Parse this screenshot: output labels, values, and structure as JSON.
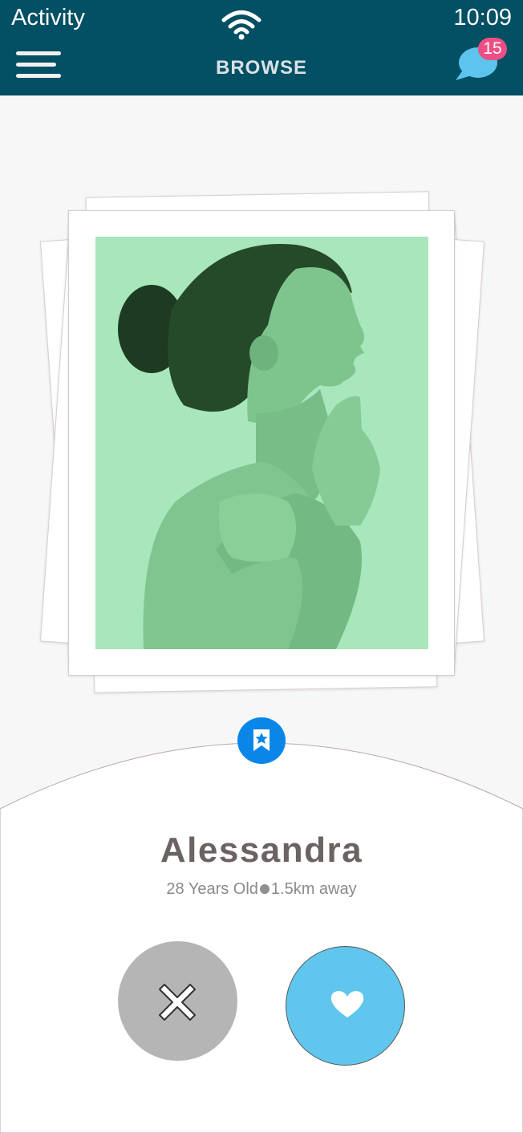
{
  "status_bar": {
    "carrier": "Activity",
    "time": "10:09"
  },
  "header": {
    "title": "BROWSE",
    "chat_badge_count": "15",
    "menu_icon": "hamburger-icon",
    "chat_icon": "chat-bubble-icon"
  },
  "profile": {
    "name": "Alessandra",
    "age_text": "28 Years Old",
    "distance_text": "1.5km away",
    "photo_tint": "#a8e6bb"
  },
  "actions": {
    "bookmark_icon": "bookmark-star-icon",
    "reject_icon": "close-x-icon",
    "like_icon": "heart-icon"
  },
  "colors": {
    "header_bg": "#034f63",
    "badge": "#ec4f83",
    "bookmark": "#0a86e8",
    "like": "#60c6ee",
    "reject": "#b6b5b5"
  }
}
